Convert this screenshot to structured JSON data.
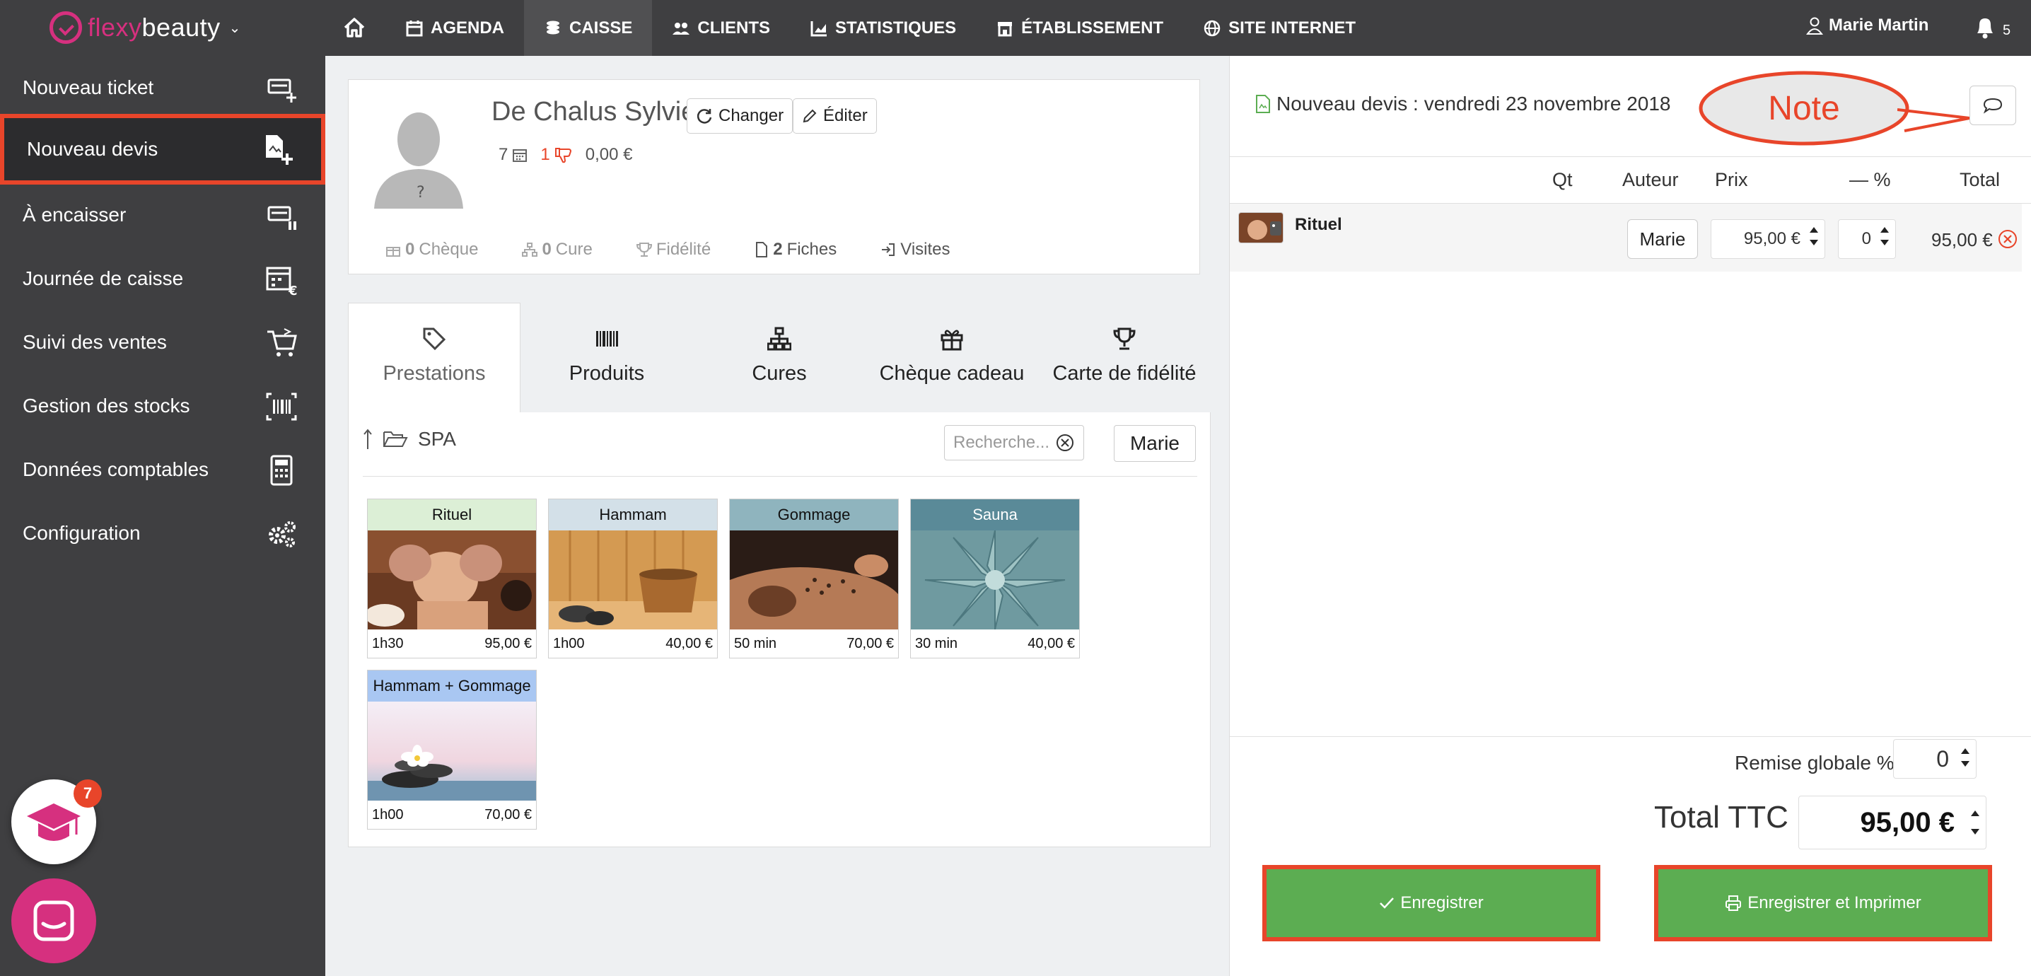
{
  "topbar": {
    "logo_flexy": "flexy",
    "logo_beauty": "beauty",
    "nav": [
      {
        "label": "AGENDA",
        "icon": "calendar-icon"
      },
      {
        "label": "CAISSE",
        "icon": "cash-register-icon"
      },
      {
        "label": "CLIENTS",
        "icon": "users-icon"
      },
      {
        "label": "STATISTIQUES",
        "icon": "chart-icon"
      },
      {
        "label": "ÉTABLISSEMENT",
        "icon": "store-icon"
      },
      {
        "label": "SITE INTERNET",
        "icon": "globe-icon"
      }
    ],
    "active_nav": "CAISSE",
    "user_name": "Marie Martin",
    "notification_count": "5"
  },
  "sidebar": {
    "items": [
      {
        "label": "Nouveau ticket",
        "icon": "new-ticket-icon"
      },
      {
        "label": "Nouveau devis",
        "icon": "new-quote-icon",
        "selected": true
      },
      {
        "label": "À encaisser",
        "icon": "pending-ticket-icon"
      },
      {
        "label": "Journée de caisse",
        "icon": "calendar-euro-icon"
      },
      {
        "label": "Suivi des ventes",
        "icon": "cart-icon"
      },
      {
        "label": "Gestion des stocks",
        "icon": "barcode-icon"
      },
      {
        "label": "Données comptables",
        "icon": "calculator-icon"
      },
      {
        "label": "Configuration",
        "icon": "gears-icon"
      }
    ],
    "academy_badge": "7"
  },
  "client": {
    "name": "De Chalus Sylvie",
    "change_label": "Changer",
    "edit_label": "Éditer",
    "avatar_mark": "?",
    "visits_count": "7",
    "dislikes_count": "1",
    "balance": "0,00 €",
    "tags": [
      {
        "count": "0",
        "label": "Chèque"
      },
      {
        "count": "0",
        "label": "Cure"
      },
      {
        "count": "",
        "label": "Fidélité"
      },
      {
        "count": "2",
        "label": "Fiches"
      },
      {
        "count": "",
        "label": "Visites"
      }
    ]
  },
  "tabs": [
    {
      "label": "Prestations",
      "icon": "tag-icon",
      "active": true
    },
    {
      "label": "Produits",
      "icon": "barcode-icon"
    },
    {
      "label": "Cures",
      "icon": "sitemap-icon"
    },
    {
      "label": "Chèque cadeau",
      "icon": "gift-icon"
    },
    {
      "label": "Carte de fidélité",
      "icon": "trophy-icon"
    }
  ],
  "catalog": {
    "folder": "SPA",
    "search_placeholder": "Recherche...",
    "staff_button": "Marie",
    "products": [
      {
        "title": "Rituel",
        "duration": "1h30",
        "price": "95,00 €",
        "header_color": "#dcefd6"
      },
      {
        "title": "Hammam",
        "duration": "1h00",
        "price": "40,00 €",
        "header_color": "#d3e0e8"
      },
      {
        "title": "Gommage",
        "duration": "50 min",
        "price": "70,00 €",
        "header_color": "#8fb4be"
      },
      {
        "title": "Sauna",
        "duration": "30 min",
        "price": "40,00 €",
        "header_color": "#5a8a98"
      },
      {
        "title": "Hammam + Gommage",
        "duration": "1h00",
        "price": "70,00 €",
        "header_color": "#a9c7f2"
      }
    ]
  },
  "quote": {
    "title": "Nouveau devis :",
    "date": "vendredi 23 novembre 2018",
    "note_callout": "Note",
    "columns": {
      "qty": "Qt",
      "author": "Auteur",
      "price": "Prix",
      "discount": "— %",
      "total": "Total"
    },
    "items": [
      {
        "name": "Rituel",
        "author": "Marie",
        "price": "95,00 €",
        "discount": "0",
        "total": "95,00 €"
      }
    ],
    "global_discount_label": "Remise globale %",
    "global_discount": "0",
    "total_label": "Total TTC",
    "total": "95,00 €",
    "save_label": "Enregistrer",
    "save_print_label": "Enregistrer et Imprimer"
  },
  "colors": {
    "brand": "#d6307f",
    "highlight": "#e8452a",
    "action_green": "#5cad52",
    "bar": "#3f3f41"
  }
}
